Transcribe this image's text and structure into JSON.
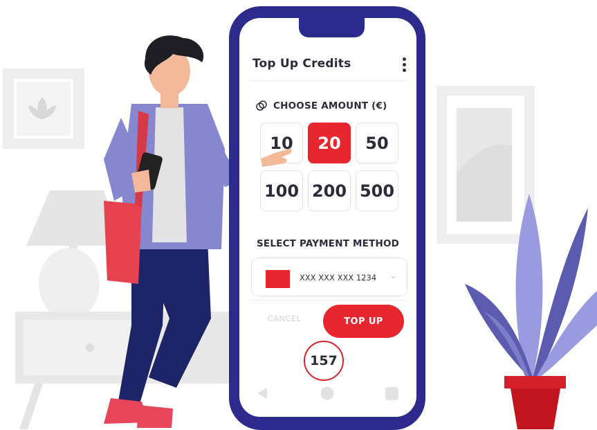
{
  "screen": {
    "title": "Top Up Credits",
    "amount_label": "CHOOSE AMOUNT (€)",
    "amounts": [
      "10",
      "20",
      "50",
      "100",
      "200",
      "500"
    ],
    "selected_amount": "20",
    "payment_label": "SELECT PAYMENT METHOD",
    "card_number": "XXX XXX XXX 1234",
    "cancel_label": "CANCEL",
    "topup_label": "TOP UP",
    "badge": "157"
  },
  "icons": [
    "more-vert-icon",
    "coin-icon",
    "chevron-down-icon",
    "back-nav-icon",
    "home-nav-icon",
    "recent-apps-icon"
  ],
  "colors": {
    "accent": "#e82630",
    "phone_frame": "#2c2a8c",
    "plant_leaf": "#8f8fd8",
    "shirt": "#8787cf",
    "pants": "#1e2468",
    "background_items": "#eeeeee"
  }
}
